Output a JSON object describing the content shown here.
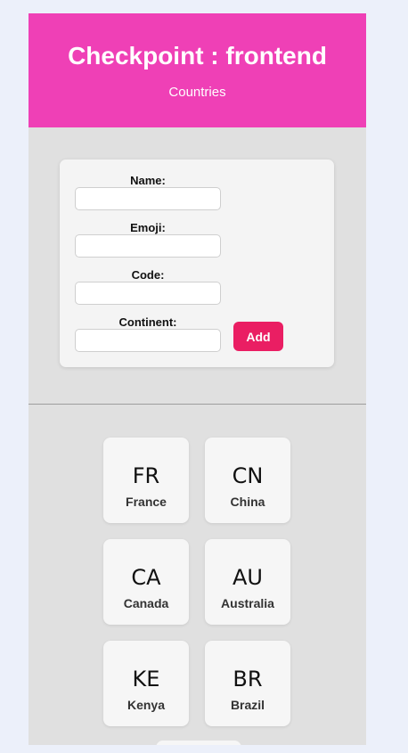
{
  "header": {
    "title": "Checkpoint : frontend",
    "subtitle": "Countries"
  },
  "form": {
    "name_label": "Name:",
    "emoji_label": "Emoji:",
    "code_label": "Code:",
    "continent_label": "Continent:",
    "name_value": "",
    "emoji_value": "",
    "code_value": "",
    "continent_value": "",
    "add_label": "Add"
  },
  "countries": [
    {
      "code": "FR",
      "name": "France"
    },
    {
      "code": "CN",
      "name": "China"
    },
    {
      "code": "CA",
      "name": "Canada"
    },
    {
      "code": "AU",
      "name": "Australia"
    },
    {
      "code": "KE",
      "name": "Kenya"
    },
    {
      "code": "BR",
      "name": "Brazil"
    }
  ],
  "colors": {
    "header_bg": "#ef40b6",
    "add_button": "#ea1e63",
    "page_bg": "#ecf0fa",
    "content_bg": "#e0e0e0"
  }
}
